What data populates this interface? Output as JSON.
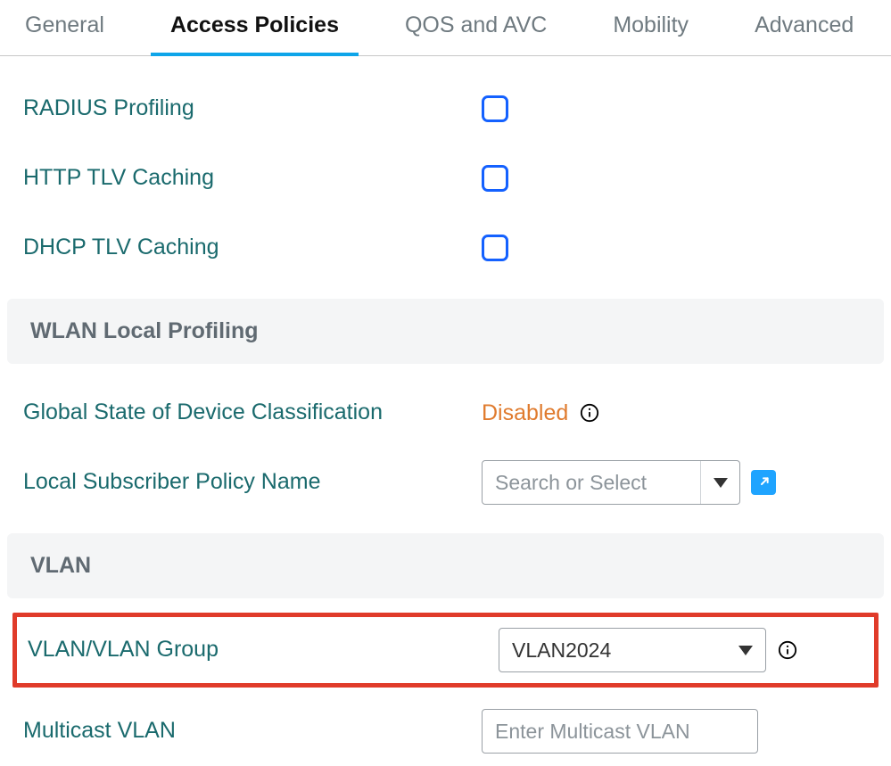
{
  "tabs": [
    {
      "label": "General",
      "active": false
    },
    {
      "label": "Access Policies",
      "active": true
    },
    {
      "label": "QOS and AVC",
      "active": false
    },
    {
      "label": "Mobility",
      "active": false
    },
    {
      "label": "Advanced",
      "active": false
    }
  ],
  "rows": {
    "radius_profiling": {
      "label": "RADIUS Profiling",
      "checked": false
    },
    "http_tlv_caching": {
      "label": "HTTP TLV Caching",
      "checked": false
    },
    "dhcp_tlv_caching": {
      "label": "DHCP TLV Caching",
      "checked": false
    }
  },
  "sections": {
    "wlan_local_profiling": "WLAN Local Profiling",
    "vlan": "VLAN"
  },
  "wlan_local_profiling": {
    "global_state_label": "Global State of Device Classification",
    "global_state_value": "Disabled",
    "local_policy_label": "Local Subscriber Policy Name",
    "local_policy_placeholder": "Search or Select",
    "local_policy_value": ""
  },
  "vlan": {
    "vlan_group_label": "VLAN/VLAN Group",
    "vlan_group_value": "VLAN2024",
    "multicast_label": "Multicast VLAN",
    "multicast_placeholder": "Enter Multicast VLAN",
    "multicast_value": ""
  },
  "colors": {
    "accent": "#0ea5e9",
    "checkbox_border": "#1461ff",
    "label_teal": "#1a6a6d",
    "status_warn": "#e07b2e",
    "highlight_red": "#e03b2a"
  }
}
